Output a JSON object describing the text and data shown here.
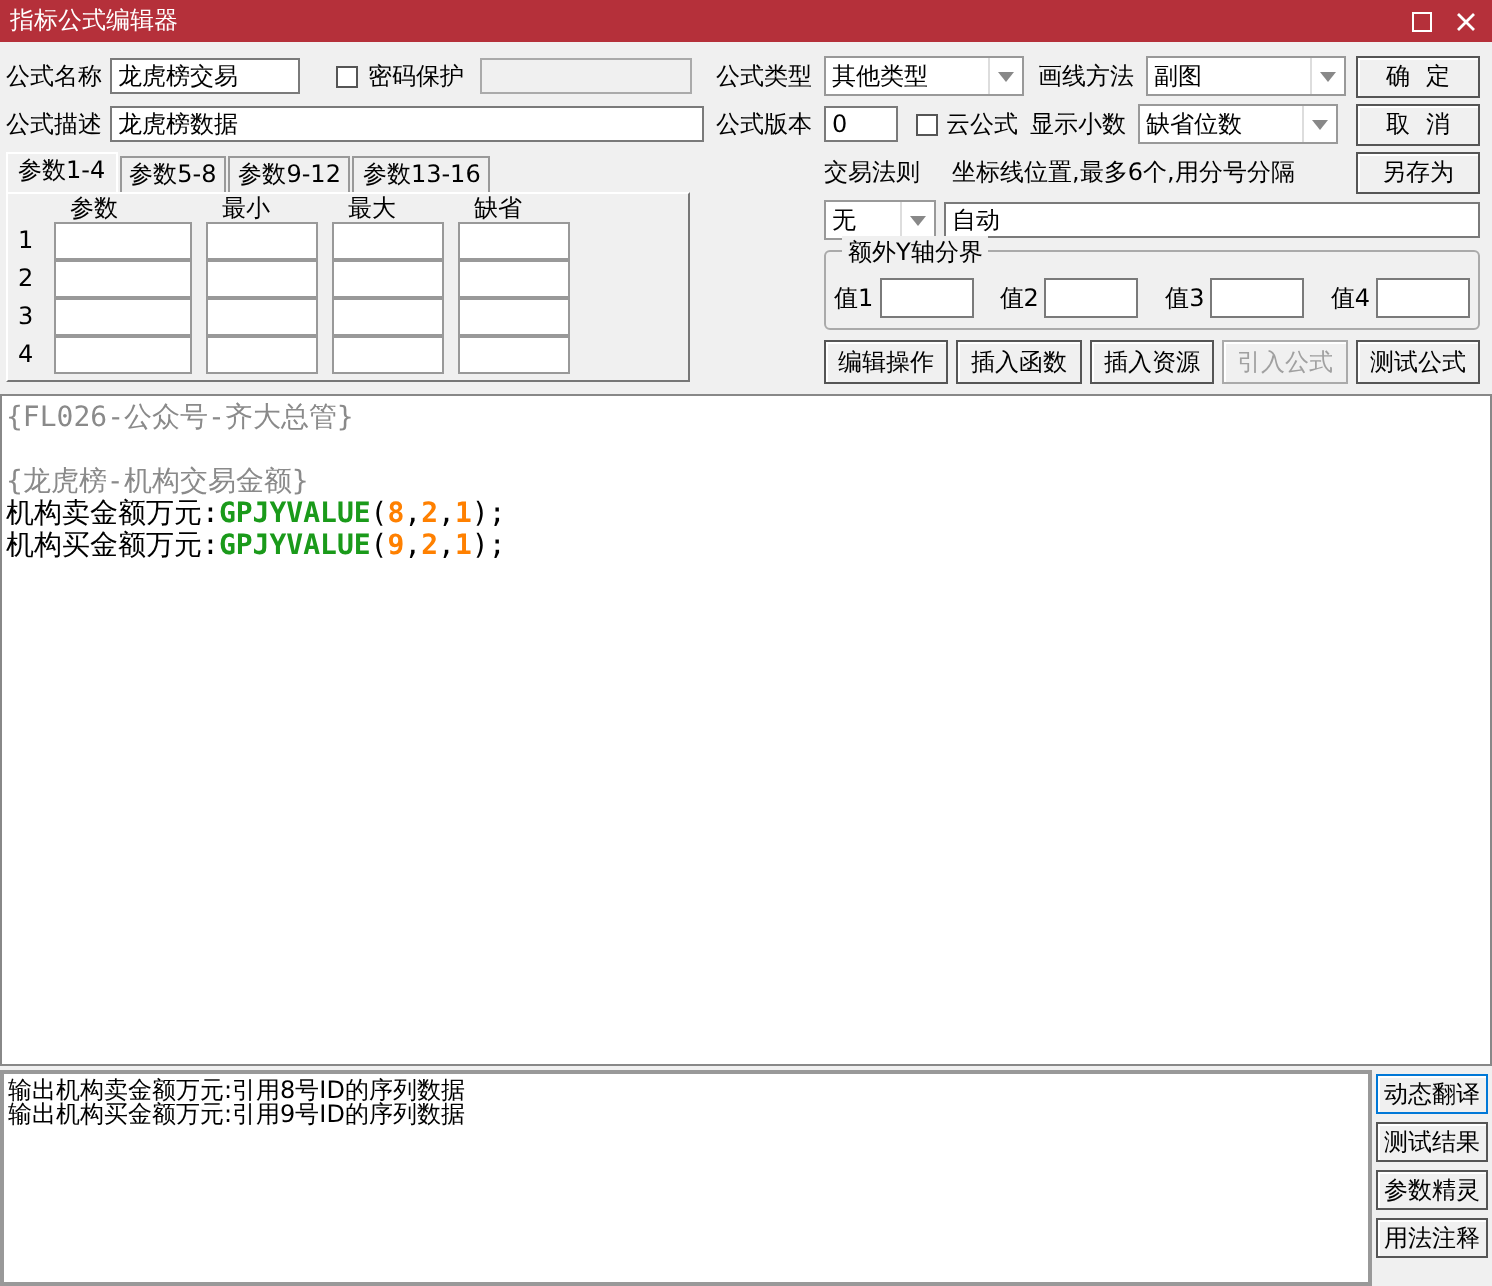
{
  "window": {
    "title": "指标公式编辑器"
  },
  "formula_name": {
    "label": "公式名称",
    "value": "龙虎榜交易"
  },
  "password": {
    "label": "密码保护",
    "checked": false
  },
  "description": {
    "label": "公式描述",
    "value": "龙虎榜数据"
  },
  "param_tabs": [
    {
      "label": "参数1-4",
      "selected": true
    },
    {
      "label": "参数5-8",
      "selected": false
    },
    {
      "label": "参数9-12",
      "selected": false
    },
    {
      "label": "参数13-16",
      "selected": false
    }
  ],
  "param_table": {
    "columns": [
      "参数",
      "最小",
      "最大",
      "缺省"
    ],
    "rows": [
      "1",
      "2",
      "3",
      "4"
    ]
  },
  "formula_type": {
    "label": "公式类型",
    "value": "其他类型"
  },
  "draw_method": {
    "label": "画线方法",
    "value": "副图"
  },
  "version": {
    "label": "公式版本",
    "value": "0"
  },
  "cloud": {
    "label": "云公式",
    "checked": false
  },
  "decimals": {
    "label": "显示小数",
    "value": "缺省位数"
  },
  "trade_rule": {
    "label": "交易法则",
    "value": "无"
  },
  "axis_lines": {
    "label": "坐标线位置,最多6个,用分号分隔",
    "value": "自动"
  },
  "y_bounds": {
    "title": "额外Y轴分界",
    "fields": [
      "值1",
      "值2",
      "值3",
      "值4"
    ]
  },
  "buttons": [
    "确  定",
    "取  消",
    "另存为"
  ],
  "tool_buttons": [
    {
      "label": "编辑操作",
      "disabled": false
    },
    {
      "label": "插入函数",
      "disabled": false
    },
    {
      "label": "插入资源",
      "disabled": false
    },
    {
      "label": "引入公式",
      "disabled": true
    },
    {
      "label": "测试公式",
      "disabled": false
    }
  ],
  "editor": {
    "lines": [
      {
        "kind": "code",
        "segments": [
          {
            "kind": "comment",
            "text": "{FL026-公众号-齐大总管}"
          }
        ]
      },
      {
        "kind": "blank"
      },
      {
        "kind": "code",
        "segments": [
          {
            "kind": "comment",
            "text": "{龙虎榜-机构交易金额}"
          }
        ]
      },
      {
        "kind": "code",
        "segments": [
          {
            "kind": "name",
            "text": "机构卖金额万元:"
          },
          {
            "kind": "func",
            "text": "GPJYVALUE"
          },
          {
            "kind": "punct",
            "text": "("
          },
          {
            "kind": "number",
            "text": "8"
          },
          {
            "kind": "punct",
            "text": ","
          },
          {
            "kind": "number",
            "text": "2"
          },
          {
            "kind": "punct",
            "text": ","
          },
          {
            "kind": "number",
            "text": "1"
          },
          {
            "kind": "punct",
            "text": ");"
          }
        ]
      },
      {
        "kind": "code",
        "segments": [
          {
            "kind": "name",
            "text": "机构买金额万元:"
          },
          {
            "kind": "func",
            "text": "GPJYVALUE"
          },
          {
            "kind": "punct",
            "text": "("
          },
          {
            "kind": "number",
            "text": "9"
          },
          {
            "kind": "punct",
            "text": ","
          },
          {
            "kind": "number",
            "text": "2"
          },
          {
            "kind": "punct",
            "text": ","
          },
          {
            "kind": "number",
            "text": "1"
          },
          {
            "kind": "punct",
            "text": ");"
          }
        ]
      }
    ]
  },
  "output": {
    "lines": [
      "输出机构卖金额万元:引用8号ID的序列数据",
      "输出机构买金额万元:引用9号ID的序列数据"
    ]
  },
  "side_buttons": [
    "动态翻译",
    "测试结果",
    "参数精灵",
    "用法注释"
  ]
}
